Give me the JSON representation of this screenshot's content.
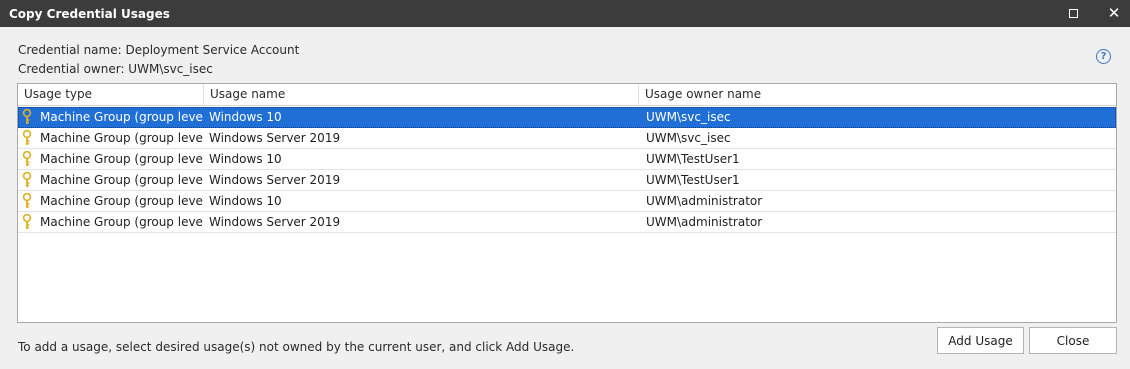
{
  "window": {
    "title": "Copy Credential Usages",
    "maximize_icon": "maximize-icon",
    "close_icon": "close-icon"
  },
  "credential": {
    "name_line": "Credential name: Deployment Service Account",
    "owner_line": "Credential owner: UWM\\svc_isec"
  },
  "help": {
    "icon": "help-icon",
    "glyph": "?"
  },
  "grid": {
    "columns": [
      "Usage type",
      "Usage name",
      "Usage owner name"
    ],
    "row_icon": "key-icon",
    "rows": [
      {
        "type": "Machine Group (group level)",
        "name": "Windows 10",
        "owner": "UWM\\svc_isec",
        "selected": true
      },
      {
        "type": "Machine Group (group level)",
        "name": "Windows Server 2019",
        "owner": "UWM\\svc_isec",
        "selected": false
      },
      {
        "type": "Machine Group (group level)",
        "name": "Windows 10",
        "owner": "UWM\\TestUser1",
        "selected": false
      },
      {
        "type": "Machine Group (group level)",
        "name": "Windows Server 2019",
        "owner": "UWM\\TestUser1",
        "selected": false
      },
      {
        "type": "Machine Group (group level)",
        "name": "Windows 10",
        "owner": "UWM\\administrator",
        "selected": false
      },
      {
        "type": "Machine Group (group level)",
        "name": "Windows Server 2019",
        "owner": "UWM\\administrator",
        "selected": false
      }
    ]
  },
  "footer": {
    "hint": "To add a usage, select desired usage(s) not owned by the current user, and click Add Usage.",
    "add_label": "Add Usage",
    "close_label": "Close"
  },
  "colors": {
    "titlebar": "#3c3c3c",
    "selection": "#1f6fd6",
    "key": "#e0b020",
    "help": "#3f76c2"
  }
}
